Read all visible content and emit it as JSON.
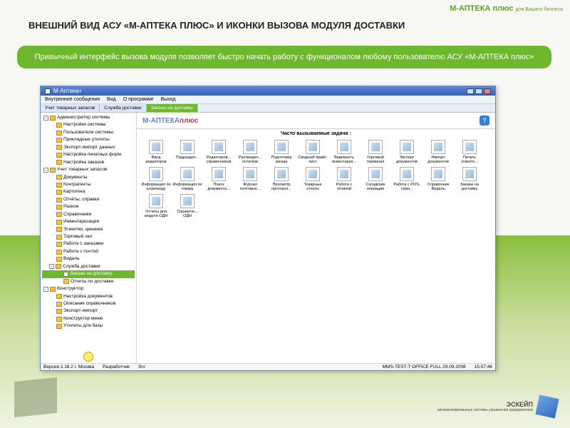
{
  "slide": {
    "top_logo": "М-АПТЕКА плюс",
    "top_tagline": "для Вашего бизнеса",
    "title": "ВНЕШНИЙ ВИД АСУ «М-АПТЕКА ПЛЮС» И ИКОНКИ ВЫЗОВА МОДУЛЯ ДОСТАВКИ",
    "banner": "Привычный интерфейс вызова модуля позволяет быстро начать работу с функционалом любому пользователю АСУ «М-АПТЕКА плюс»",
    "footer_brand": "ЭСКЕЙП",
    "footer_tagline": "автоматизированные системы управления предприятием"
  },
  "window": {
    "title": "М-Аптека+",
    "menus": [
      "Внутренние сообщения",
      "Вид",
      "О программе",
      "Выход"
    ],
    "tabs": [
      {
        "label": "Учет товарных запасов"
      },
      {
        "label": "Служба доставки"
      },
      {
        "label": "Заказы на доставку"
      }
    ],
    "logo": {
      "part1": "М-АПТЕКА",
      "part2": "плюс"
    },
    "help": "?",
    "tasks_heading": "Часто вызываемые задачи :",
    "statusbar": {
      "version": "Версия 2.18.2 г. Москва",
      "role": "Разработчик",
      "server": "Srv",
      "host": "MMS-TEST-T  OFFICE  FULL  29.09.2008",
      "time": "15:57:46"
    }
  },
  "tree": [
    {
      "label": "Администратор системы",
      "lvl": 0,
      "exp": "-"
    },
    {
      "label": "Настройки системы",
      "lvl": 1
    },
    {
      "label": "Пользователи системы",
      "lvl": 1
    },
    {
      "label": "Прикладные утилиты",
      "lvl": 1
    },
    {
      "label": "Экспорт-импорт данных",
      "lvl": 1
    },
    {
      "label": "Настройка печатных форм",
      "lvl": 1
    },
    {
      "label": "Настройка заказов",
      "lvl": 1
    },
    {
      "label": "Учет товарных запасов",
      "lvl": 0,
      "exp": "-"
    },
    {
      "label": "Документы",
      "lvl": 1
    },
    {
      "label": "Контрагенты",
      "lvl": 1
    },
    {
      "label": "Картотека",
      "lvl": 1
    },
    {
      "label": "Отчёты, справки",
      "lvl": 1
    },
    {
      "label": "Разное",
      "lvl": 1
    },
    {
      "label": "Справочники",
      "lvl": 1
    },
    {
      "label": "Инвентаризация",
      "lvl": 1
    },
    {
      "label": "Этикетки, ценники",
      "lvl": 1
    },
    {
      "label": "Торговый зал",
      "lvl": 1
    },
    {
      "label": "Работа с заказами",
      "lvl": 1
    },
    {
      "label": "Работа с почтой",
      "lvl": 1
    },
    {
      "label": "Видаль",
      "lvl": 1
    },
    {
      "label": "Служба доставки",
      "lvl": 1,
      "exp": "-"
    },
    {
      "label": "Заказы на доставку",
      "lvl": 2,
      "selected": true
    },
    {
      "label": "Отчеты по доставке",
      "lvl": 2
    },
    {
      "label": "Конструктор",
      "lvl": 0,
      "exp": "-"
    },
    {
      "label": "Настройка документов",
      "lvl": 1
    },
    {
      "label": "Описание справочников",
      "lvl": 1
    },
    {
      "label": "Экспорт-импорт",
      "lvl": 1
    },
    {
      "label": "Конструктор меню",
      "lvl": 1
    },
    {
      "label": "Утилиты для базы",
      "lvl": 1
    }
  ],
  "tasks": [
    {
      "name": "vvod-redaktorov",
      "label": "Ввод редакторов"
    },
    {
      "name": "podrazdeleniya",
      "label": "Подраздел..."
    },
    {
      "name": "redaktirov-spravochnikov",
      "label": "Редактиров... справочников"
    },
    {
      "name": "raspredel-ostatkov",
      "label": "Распредел... остатков"
    },
    {
      "name": "podgotovka-zakaza",
      "label": "Подготовка заказа"
    },
    {
      "name": "svodnyy-prays-list",
      "label": "Сводный прайс-лист"
    },
    {
      "name": "vedomost-inventariz",
      "label": "Ведомость инвентариз..."
    },
    {
      "name": "torgovyy-terminal",
      "label": "Торговый терминал"
    },
    {
      "name": "eksport-dokumentov",
      "label": "Экспорт документов"
    },
    {
      "name": "import-dokumentov",
      "label": "Импорт документов"
    },
    {
      "name": "pechat-etiketo",
      "label": "Печать этикето..."
    },
    {
      "name": "info-po-shtrikhkodu",
      "label": "Информация по штрихкоду"
    },
    {
      "name": "info-po-tovaru",
      "label": "Информация по товару"
    },
    {
      "name": "poisk-dokumenta",
      "label": "Поиск документа..."
    },
    {
      "name": "zhurnal-pochtovykh",
      "label": "Журнал почтовых..."
    },
    {
      "name": "prosmotr-protokol",
      "label": "Просмотр протокол..."
    },
    {
      "name": "tovarnye-otchety",
      "label": "Товарные отчеты"
    },
    {
      "name": "rabota-s-optikoy",
      "label": "Работа с оптикой"
    },
    {
      "name": "skladskie-operatsii",
      "label": "Складские операции"
    },
    {
      "name": "rabota-s-pos-term",
      "label": "Работа с POS-терм..."
    },
    {
      "name": "spravochnik-vidal",
      "label": "Справочник Видаль"
    },
    {
      "name": "zakazy-na-dostavku",
      "label": "Заказы на доставку"
    },
    {
      "name": "otchety-modul-odn",
      "label": "Отчеты для модуля ОДН"
    },
    {
      "name": "spravochniki-odn",
      "label": "Справочн... ОДН"
    }
  ]
}
